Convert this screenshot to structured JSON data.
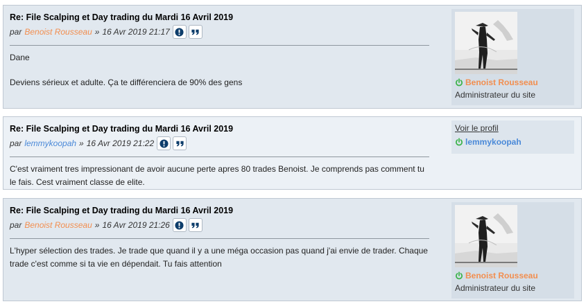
{
  "posts": [
    {
      "title": "Re: File Scalping et Day trading du Mardi 16 Avril 2019",
      "by": "par",
      "author": "Benoist Rousseau",
      "sep": "»",
      "date": "16 Avr 2019 21:17",
      "content": [
        "Dane",
        "Deviens sérieux et adulte. Ça te différenciera de 90% des gens"
      ],
      "profile": {
        "name": "Benoist Rousseau",
        "rank": "Administrateur du site"
      }
    },
    {
      "title": "Re: File Scalping et Day trading du Mardi 16 Avril 2019",
      "by": "par",
      "author": "lemmykoopah",
      "sep": "»",
      "date": "16 Avr 2019 21:22",
      "content": [
        "C'est vraiment tres impressionant de avoir aucune perte apres 80 trades Benoist. Je comprends pas comment tu le fais. Cest vraiment classe de elite."
      ],
      "profile": {
        "view_profile": "Voir le profil",
        "name": "lemmykoopah"
      }
    },
    {
      "title": "Re: File Scalping et Day trading du Mardi 16 Avril 2019",
      "by": "par",
      "author": "Benoist Rousseau",
      "sep": "»",
      "date": "16 Avr 2019 21:26",
      "content": [
        "L'hyper sélection des trades. Je trade que quand il y a une méga occasion pas quand j'ai envie de trader. Chaque trade c'est comme si ta vie en dépendait. Tu fais attention"
      ],
      "profile": {
        "name": "Benoist Rousseau",
        "rank": "Administrateur du site"
      }
    }
  ],
  "colors": {
    "admin_name": "#f28e4f",
    "user_name": "#4a89d8",
    "online_icon": "#3cb34a",
    "button_icon": "#0d3d6b"
  },
  "icons": [
    "info-report-icon",
    "quote-icon",
    "online-power-icon"
  ]
}
